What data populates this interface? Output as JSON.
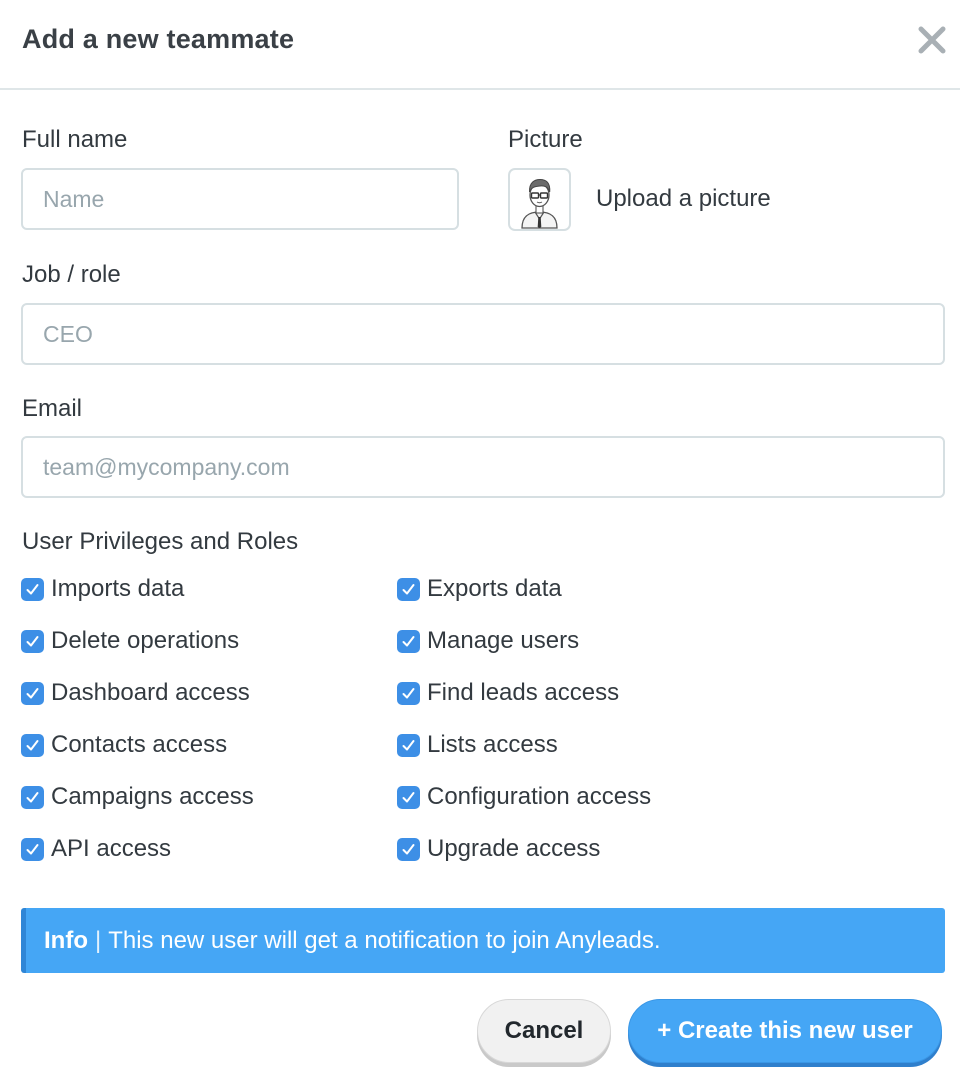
{
  "dialog": {
    "title": "Add a new teammate"
  },
  "form": {
    "full_name": {
      "label": "Full name",
      "placeholder": "Name",
      "value": ""
    },
    "picture": {
      "label": "Picture",
      "upload_label": "Upload a picture"
    },
    "job_role": {
      "label": "Job / role",
      "placeholder": "CEO",
      "value": ""
    },
    "email": {
      "label": "Email",
      "placeholder": "team@mycompany.com",
      "value": ""
    }
  },
  "privileges": {
    "heading": "User Privileges and Roles",
    "left": [
      {
        "label": "Imports data",
        "checked": true
      },
      {
        "label": "Delete operations",
        "checked": true
      },
      {
        "label": "Dashboard access",
        "checked": true
      },
      {
        "label": "Contacts access",
        "checked": true
      },
      {
        "label": "Campaigns access",
        "checked": true
      },
      {
        "label": "API access",
        "checked": true
      }
    ],
    "right": [
      {
        "label": "Exports data",
        "checked": true
      },
      {
        "label": "Manage users",
        "checked": true
      },
      {
        "label": "Find leads access",
        "checked": true
      },
      {
        "label": "Lists access",
        "checked": true
      },
      {
        "label": "Configuration access",
        "checked": true
      },
      {
        "label": "Upgrade access",
        "checked": true
      }
    ]
  },
  "info": {
    "strong": "Info",
    "separator": "|",
    "text": "This new user will get a notification to join Anyleads."
  },
  "buttons": {
    "cancel": "Cancel",
    "create": "+ Create this new user"
  },
  "colors": {
    "accent": "#45a6f5",
    "checkbox": "#3d8fe6",
    "text": "#333a40",
    "placeholder": "#98a6ad",
    "border": "#d6dfe2"
  }
}
